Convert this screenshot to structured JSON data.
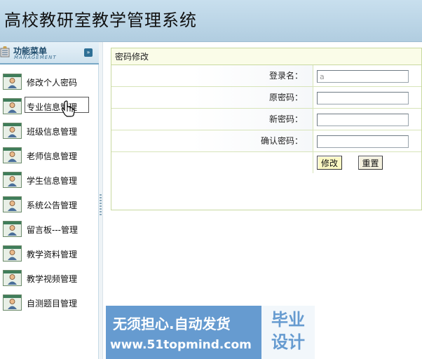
{
  "app": {
    "title": "高校教研室教学管理系统"
  },
  "sidebar": {
    "header": {
      "title": "功能菜单",
      "subtitle": "MANAGEMENT",
      "collapse_icon": "chevron-double-down-icon"
    },
    "items": [
      {
        "label": "修改个人密码"
      },
      {
        "label": "专业信息管理"
      },
      {
        "label": "班级信息管理"
      },
      {
        "label": "老师信息管理"
      },
      {
        "label": "学生信息管理"
      },
      {
        "label": "系统公告管理"
      },
      {
        "label": "留言板---管理"
      },
      {
        "label": "教学资料管理"
      },
      {
        "label": "教学视频管理"
      },
      {
        "label": "自测题目管理"
      }
    ],
    "active_index": 1
  },
  "main": {
    "panel_title": "密码修改",
    "fields": [
      {
        "label": "登录名：",
        "value": "a"
      },
      {
        "label": "原密码：",
        "value": ""
      },
      {
        "label": "新密码：",
        "value": ""
      },
      {
        "label": "确认密码：",
        "value": ""
      }
    ],
    "buttons": {
      "submit_label": "修改",
      "reset_label": "重置"
    }
  },
  "watermark": {
    "line1": "无须担心.自动发货",
    "line2": "www.51topmind.com",
    "side": "毕业\n设计"
  },
  "colors": {
    "header_bg": "#b8d3e6",
    "panel_border": "#c8d9a0",
    "panel_title_bg": "#fafce8",
    "watermark_bg": "#3c7fc3"
  }
}
